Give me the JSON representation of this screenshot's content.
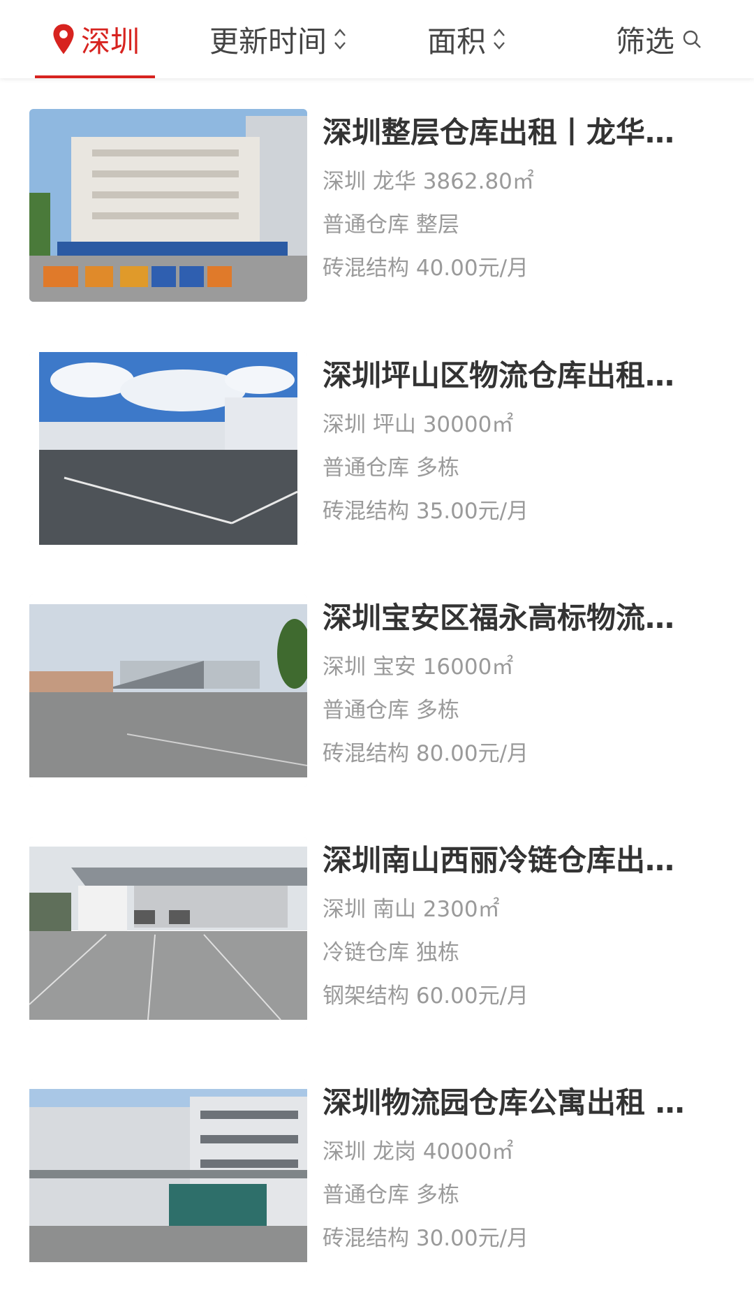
{
  "filter_bar": {
    "city": "深圳",
    "sort_time": "更新时间",
    "sort_area": "面积",
    "filter": "筛选",
    "accent_color": "#d7231f"
  },
  "listings": [
    {
      "title": "深圳整层仓库出租丨龙华…",
      "location_area": "深圳 龙华 3862.80㎡",
      "type": "普通仓库 整层",
      "structure_price": "砖混结构 40.00元/月",
      "image": "multi-storey-warehouse-with-trucks"
    },
    {
      "title": "深圳坪山区物流仓库出租…",
      "location_area": "深圳 坪山 30000㎡",
      "type": "普通仓库 多栋",
      "structure_price": "砖混结构 35.00元/月",
      "image": "logistics-warehouse-with-yard"
    },
    {
      "title": "深圳宝安区福永高标物流…",
      "location_area": "深圳 宝安 16000㎡",
      "type": "普通仓库 多栋",
      "structure_price": "砖混结构 80.00元/月",
      "image": "warehouse-open-yard"
    },
    {
      "title": "深圳南山西丽冷链仓库出…",
      "location_area": "深圳 南山 2300㎡",
      "type": "冷链仓库 独栋",
      "structure_price": "钢架结构 60.00元/月",
      "image": "cold-chain-loading-dock"
    },
    {
      "title": "深圳物流园仓库公寓出租 …",
      "location_area": "深圳 龙岗 40000㎡",
      "type": "普通仓库 多栋",
      "structure_price": "砖混结构 30.00元/月",
      "image": "logistics-park-building"
    }
  ]
}
